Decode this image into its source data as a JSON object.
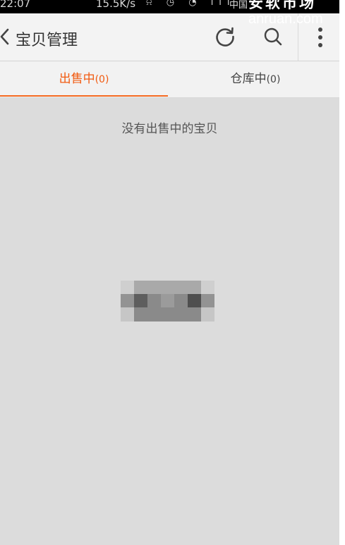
{
  "statusbar": {
    "time": "22:07",
    "speed": "15.5K/s",
    "icons": "⍾ ◷ ◔ ıll",
    "carrier": "中国"
  },
  "watermark": {
    "cn": "安软市场",
    "en": "anruan.com"
  },
  "header": {
    "title": "宝贝管理",
    "icons": [
      "back-icon",
      "refresh-icon",
      "search-icon",
      "more-icon"
    ]
  },
  "tabs": [
    {
      "label": "出售中",
      "count": "(0)",
      "active": true
    },
    {
      "label": "仓库中",
      "count": "(0)",
      "active": false
    }
  ],
  "content": {
    "empty_message": "没有出售中的宝贝"
  },
  "colors": {
    "accent": "#f15a10",
    "background": "#dcdcdc",
    "header_bg": "#f3f3f3"
  }
}
